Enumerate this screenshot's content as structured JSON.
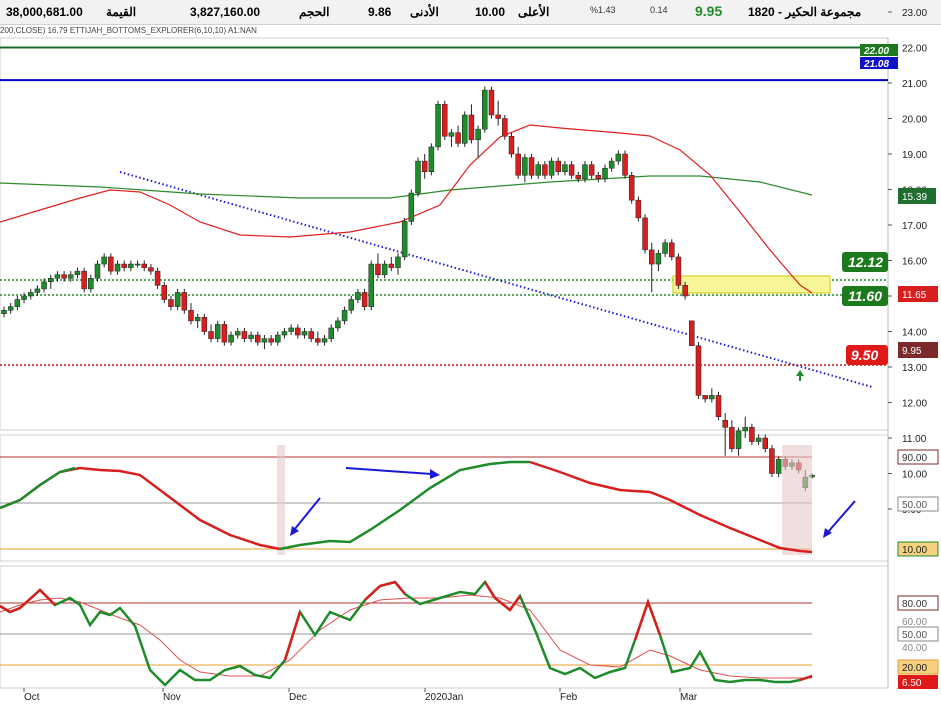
{
  "header": {
    "title": "1820 - مجموعة الحكير",
    "last_price": "9.95",
    "change": "0.14",
    "change_pct": "%1.43",
    "high_label": "الأعلى",
    "high_value": "10.00",
    "low_label": "الأدنى",
    "low_value": "9.86",
    "volume_label": "الحجم",
    "volume_value": "3,827,160.00",
    "value_label": "القيمة",
    "value_value": "38,000,681.00"
  },
  "indicator_line": "200,CLOSE)   16.79   ETTIJAH_BOTTOMS_EXPLORER(6,10,10)   A1:NAN",
  "price_axis": {
    "ticks": [
      "23.00",
      "22.00",
      "21.00",
      "20.00",
      "19.00",
      "18.00",
      "17.00",
      "16.00",
      "15.00",
      "14.00",
      "13.00",
      "12.00",
      "11.00",
      "10.00",
      "9.00"
    ],
    "marker_top_green": "22.00",
    "marker_top_blue": "21.08",
    "marker_ma200": "15.39",
    "marker_ma_red": "11.65",
    "marker_last": "9.95"
  },
  "level_labels": {
    "resistance_1": "12.12",
    "resistance_2": "11.60",
    "support": "9.50"
  },
  "osc1_axis": {
    "top": "90.00",
    "mid": "50.00",
    "bottom": "10.00"
  },
  "osc2_axis": {
    "l80": "80.00",
    "l60": "60.00",
    "l50": "50.00",
    "l40": "40.00",
    "l20": "20.00",
    "last": "6.50"
  },
  "time_axis": [
    "Oct",
    "Nov",
    "Dec",
    "2020Jan",
    "Feb",
    "Mar"
  ],
  "colors": {
    "up": "#1e8c2a",
    "down": "#d81e1e",
    "accent_blue": "#0000cc"
  },
  "chart_data": {
    "type": "candlestick",
    "candles": [
      [
        14.5,
        14.7,
        14.4,
        14.6
      ],
      [
        14.6,
        14.8,
        14.5,
        14.7
      ],
      [
        14.7,
        15.0,
        14.6,
        14.9
      ],
      [
        14.9,
        15.1,
        14.8,
        15.0
      ],
      [
        15.0,
        15.2,
        14.9,
        15.1
      ],
      [
        15.1,
        15.3,
        15.0,
        15.2
      ],
      [
        15.2,
        15.5,
        15.1,
        15.4
      ],
      [
        15.4,
        15.6,
        15.2,
        15.5
      ],
      [
        15.5,
        15.7,
        15.4,
        15.6
      ],
      [
        15.6,
        15.7,
        15.4,
        15.5
      ],
      [
        15.5,
        15.7,
        15.4,
        15.6
      ],
      [
        15.6,
        15.8,
        15.5,
        15.7
      ],
      [
        15.7,
        15.8,
        15.1,
        15.2
      ],
      [
        15.2,
        15.6,
        15.1,
        15.5
      ],
      [
        15.5,
        16.0,
        15.4,
        15.9
      ],
      [
        15.9,
        16.2,
        15.8,
        16.1
      ],
      [
        16.1,
        16.2,
        15.6,
        15.7
      ],
      [
        15.7,
        16.0,
        15.6,
        15.9
      ],
      [
        15.9,
        16.0,
        15.7,
        15.8
      ],
      [
        15.8,
        16.0,
        15.7,
        15.9
      ],
      [
        15.9,
        16.0,
        15.8,
        15.9
      ],
      [
        15.9,
        16.0,
        15.7,
        15.8
      ],
      [
        15.8,
        15.9,
        15.6,
        15.7
      ],
      [
        15.7,
        15.8,
        15.2,
        15.3
      ],
      [
        15.3,
        15.4,
        14.8,
        14.9
      ],
      [
        14.9,
        15.0,
        14.6,
        14.7
      ],
      [
        14.7,
        15.2,
        14.6,
        15.1
      ],
      [
        15.1,
        15.2,
        14.5,
        14.6
      ],
      [
        14.6,
        14.8,
        14.2,
        14.3
      ],
      [
        14.3,
        14.5,
        14.1,
        14.4
      ],
      [
        14.4,
        14.5,
        13.9,
        14.0
      ],
      [
        14.0,
        14.2,
        13.7,
        13.8
      ],
      [
        13.8,
        14.3,
        13.7,
        14.2
      ],
      [
        14.2,
        14.3,
        13.6,
        13.7
      ],
      [
        13.7,
        14.0,
        13.6,
        13.9
      ],
      [
        13.9,
        14.1,
        13.8,
        14.0
      ],
      [
        14.0,
        14.1,
        13.7,
        13.8
      ],
      [
        13.8,
        14.0,
        13.7,
        13.9
      ],
      [
        13.9,
        14.0,
        13.6,
        13.7
      ],
      [
        13.7,
        13.9,
        13.5,
        13.8
      ],
      [
        13.8,
        13.9,
        13.6,
        13.7
      ],
      [
        13.7,
        14.0,
        13.6,
        13.9
      ],
      [
        13.9,
        14.1,
        13.8,
        14.0
      ],
      [
        14.0,
        14.2,
        13.9,
        14.1
      ],
      [
        14.1,
        14.2,
        13.8,
        13.9
      ],
      [
        13.9,
        14.1,
        13.8,
        14.0
      ],
      [
        14.0,
        14.1,
        13.7,
        13.8
      ],
      [
        13.8,
        14.0,
        13.6,
        13.7
      ],
      [
        13.7,
        13.9,
        13.6,
        13.8
      ],
      [
        13.8,
        14.2,
        13.7,
        14.1
      ],
      [
        14.1,
        14.4,
        14.0,
        14.3
      ],
      [
        14.3,
        14.7,
        14.2,
        14.6
      ],
      [
        14.6,
        15.0,
        14.5,
        14.9
      ],
      [
        14.9,
        15.2,
        14.8,
        15.1
      ],
      [
        15.1,
        15.2,
        14.6,
        14.7
      ],
      [
        14.7,
        16.0,
        14.6,
        15.9
      ],
      [
        15.9,
        16.2,
        15.5,
        15.6
      ],
      [
        15.6,
        16.0,
        15.5,
        15.9
      ],
      [
        15.9,
        16.1,
        15.7,
        15.8
      ],
      [
        15.8,
        16.2,
        15.6,
        16.1
      ],
      [
        16.1,
        17.2,
        16.0,
        17.1
      ],
      [
        17.1,
        18.0,
        17.0,
        17.9
      ],
      [
        17.9,
        18.9,
        17.8,
        18.8
      ],
      [
        18.8,
        19.0,
        18.3,
        18.5
      ],
      [
        18.5,
        19.3,
        18.4,
        19.2
      ],
      [
        19.2,
        20.5,
        19.1,
        20.4
      ],
      [
        20.4,
        20.5,
        19.4,
        19.5
      ],
      [
        19.5,
        19.7,
        19.2,
        19.6
      ],
      [
        19.6,
        19.8,
        19.2,
        19.3
      ],
      [
        19.3,
        20.2,
        19.2,
        20.1
      ],
      [
        20.1,
        20.4,
        19.3,
        19.4
      ],
      [
        19.4,
        19.8,
        18.9,
        19.7
      ],
      [
        19.7,
        20.9,
        19.6,
        20.8
      ],
      [
        20.8,
        20.9,
        20.0,
        20.1
      ],
      [
        20.1,
        20.5,
        19.8,
        20.0
      ],
      [
        20.0,
        20.1,
        19.4,
        19.5
      ],
      [
        19.5,
        19.6,
        18.9,
        19.0
      ],
      [
        19.0,
        19.2,
        18.3,
        18.4
      ],
      [
        18.4,
        19.0,
        18.2,
        18.9
      ],
      [
        18.9,
        19.0,
        18.3,
        18.4
      ],
      [
        18.4,
        18.8,
        18.3,
        18.7
      ],
      [
        18.7,
        18.8,
        18.3,
        18.4
      ],
      [
        18.4,
        18.9,
        18.3,
        18.8
      ],
      [
        18.8,
        18.9,
        18.4,
        18.5
      ],
      [
        18.5,
        18.8,
        18.4,
        18.7
      ],
      [
        18.7,
        18.8,
        18.3,
        18.4
      ],
      [
        18.4,
        18.5,
        18.2,
        18.3
      ],
      [
        18.3,
        18.8,
        18.2,
        18.7
      ],
      [
        18.7,
        18.8,
        18.3,
        18.4
      ],
      [
        18.4,
        18.5,
        18.2,
        18.3
      ],
      [
        18.3,
        18.7,
        18.2,
        18.6
      ],
      [
        18.6,
        18.9,
        18.5,
        18.8
      ],
      [
        18.8,
        19.1,
        18.7,
        19.0
      ],
      [
        19.0,
        19.1,
        18.3,
        18.4
      ],
      [
        18.4,
        18.5,
        17.6,
        17.7
      ],
      [
        17.7,
        17.8,
        17.1,
        17.2
      ],
      [
        17.2,
        17.3,
        16.2,
        16.3
      ],
      [
        16.3,
        16.5,
        15.1,
        15.9
      ],
      [
        15.9,
        16.3,
        15.7,
        16.2
      ],
      [
        16.2,
        16.6,
        16.1,
        16.5
      ],
      [
        16.5,
        16.6,
        16.0,
        16.1
      ],
      [
        16.1,
        16.2,
        15.2,
        15.3
      ],
      [
        15.3,
        15.4,
        14.9,
        15.0
      ],
      [
        14.3,
        14.3,
        13.6,
        13.6
      ],
      [
        13.6,
        13.7,
        12.1,
        12.2
      ],
      [
        12.2,
        12.2,
        12.0,
        12.1
      ],
      [
        12.1,
        12.4,
        12.0,
        12.2
      ],
      [
        12.2,
        12.3,
        11.5,
        11.6
      ],
      [
        11.5,
        11.7,
        10.5,
        11.3
      ],
      [
        11.3,
        11.5,
        10.6,
        10.7
      ],
      [
        10.7,
        11.3,
        10.5,
        11.2
      ],
      [
        11.2,
        11.6,
        11.0,
        11.3
      ],
      [
        11.3,
        11.4,
        10.8,
        10.9
      ],
      [
        10.9,
        11.1,
        10.8,
        11.0
      ],
      [
        11.0,
        11.1,
        10.6,
        10.7
      ],
      [
        10.7,
        10.8,
        9.9,
        10.0
      ],
      [
        10.0,
        10.5,
        9.9,
        10.4
      ],
      [
        10.4,
        10.5,
        10.1,
        10.2
      ],
      [
        10.2,
        10.4,
        10.1,
        10.3
      ],
      [
        10.3,
        10.4,
        10.0,
        10.1
      ],
      [
        9.6,
        10.1,
        9.5,
        9.9
      ],
      [
        9.9,
        10.0,
        9.86,
        9.95
      ]
    ]
  }
}
